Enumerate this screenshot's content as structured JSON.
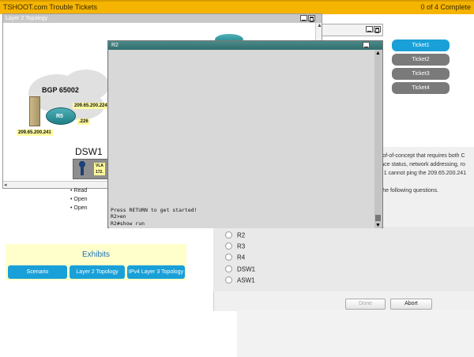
{
  "header": {
    "title": "TSHOOT.com Trouble Tickets",
    "progress": "0 of 4 Complete"
  },
  "tickets": [
    {
      "label": "Ticket1",
      "active": true
    },
    {
      "label": "Ticket2",
      "active": false
    },
    {
      "label": "Ticket3",
      "active": false
    },
    {
      "label": "Ticket4",
      "active": false
    }
  ],
  "topology_window": {
    "title": "Layer 2 Topology",
    "bgp_label": "BGP 65002",
    "router_label": "R5",
    "ip_labels": [
      "209.65.200.224",
      ".226",
      "209.65.200.241"
    ],
    "dsw_label": "DSW1",
    "vlan_label": "VLA",
    "vlan_ip": "172."
  },
  "console": {
    "title": "R2",
    "lines": [
      "Press RETURN to get started!",
      "R2>en",
      "R2#show run"
    ]
  },
  "question": {
    "lines": [
      "roof-of-concept that requires both C",
      "rface status, network addressing, ro",
      "nt 1 cannot ping the 209.65.200.241",
      "",
      "r the following questions."
    ],
    "options": [
      "R2",
      "R3",
      "R4",
      "DSW1",
      "ASW1"
    ],
    "done_label": "Done",
    "abort_label": "Abort"
  },
  "bullets": [
    "Read",
    "Open",
    "Open"
  ],
  "exhibits": {
    "title": "Exhibits",
    "buttons": [
      "Scenario",
      "Layer 2 Topology",
      "IPv4 Layer 3 Topology"
    ]
  }
}
